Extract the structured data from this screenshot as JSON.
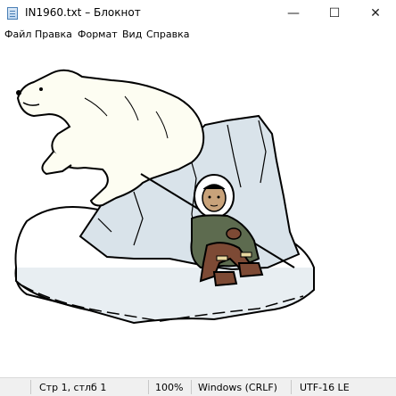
{
  "window": {
    "title": "IN1960.txt – Блокнот",
    "controls": {
      "minimize": "—",
      "maximize": "☐",
      "close": "✕"
    }
  },
  "menu": {
    "items": [
      "Файл",
      "Правка",
      "Формат",
      "Вид",
      "Справка"
    ]
  },
  "editor": {
    "content_image": "polar-bear-and-inuit-on-ice-floe"
  },
  "status": {
    "position": "Стр 1, стлб 1",
    "zoom": "100%",
    "line_endings": "Windows (CRLF)",
    "encoding": "UTF-16 LE"
  }
}
